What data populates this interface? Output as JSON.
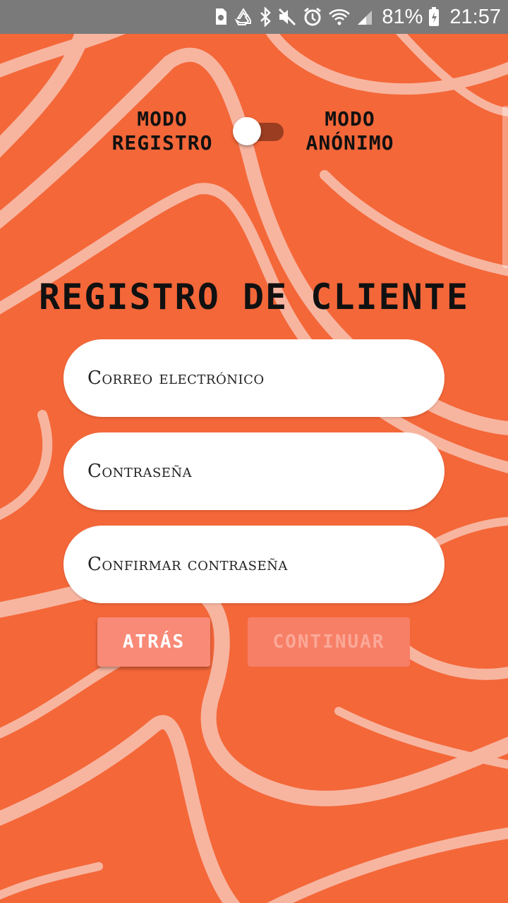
{
  "status_bar": {
    "icons": [
      "sd-card-icon",
      "recycle-icon",
      "bluetooth-icon",
      "mute-icon",
      "alarm-icon",
      "wifi-icon",
      "signal-icon",
      "battery-charging-icon"
    ],
    "battery": "81%",
    "time": "21:57"
  },
  "mode_toggle": {
    "left_label": "MODO REGISTRO",
    "right_label": "MODO ANÓNIMO",
    "state": "registro"
  },
  "title": "REGISTRO DE CLIENTE",
  "form": {
    "email_placeholder": "Correo electrónico",
    "password_placeholder": "Contraseña",
    "confirm_placeholder": "Confirmar contraseña"
  },
  "buttons": {
    "back": "ATRÁS",
    "continue": "CONTINUAR"
  },
  "colors": {
    "background": "#f46739",
    "wave": "#f7b5a0",
    "status_bar": "#7a7a7a",
    "button_back": "#f98a77",
    "button_continue_disabled": "#f77f66"
  }
}
